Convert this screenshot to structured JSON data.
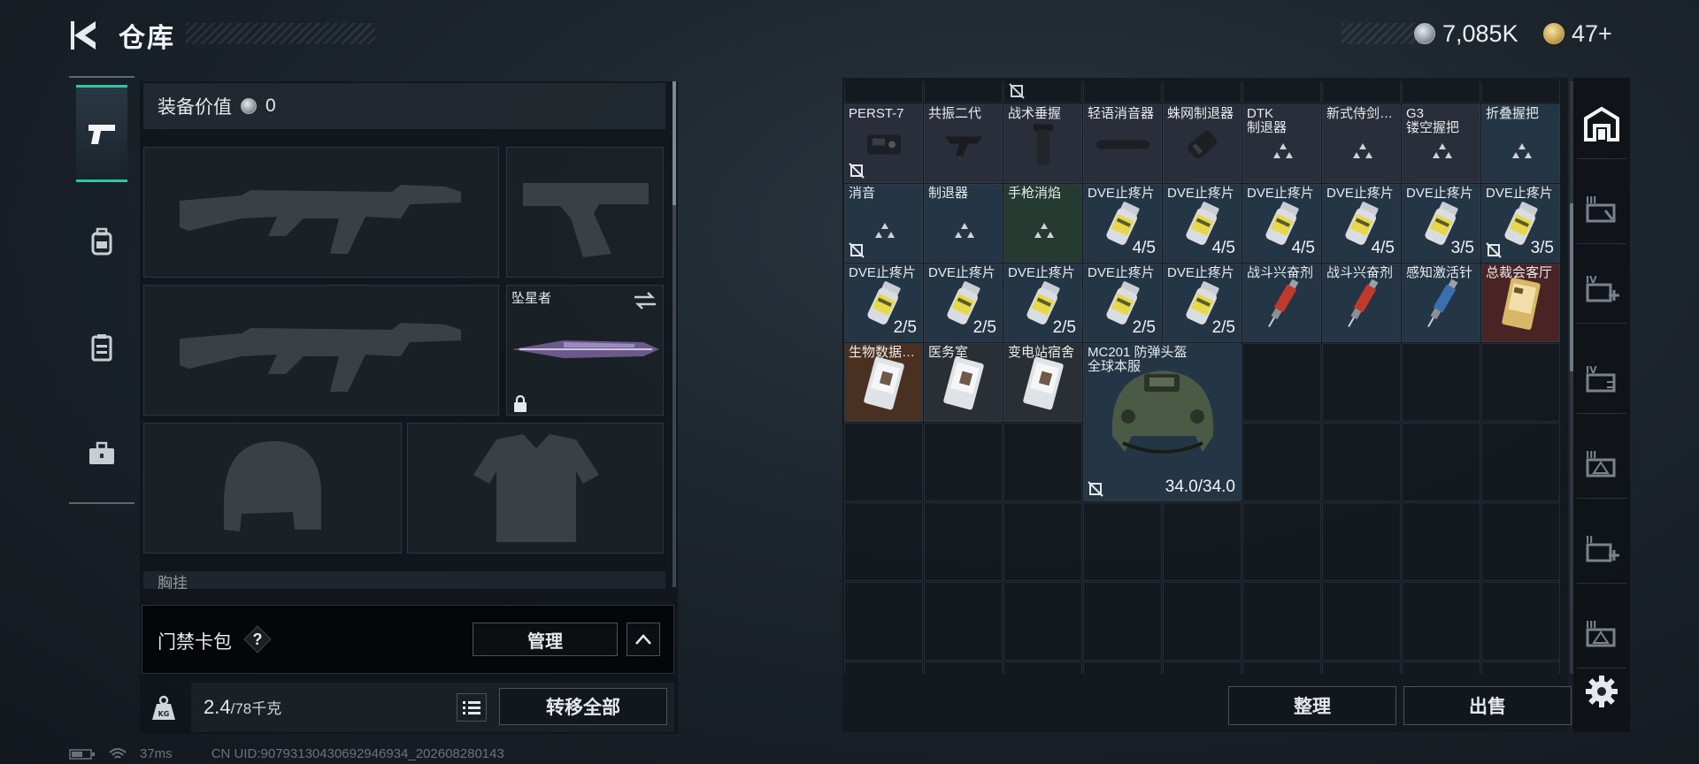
{
  "header": {
    "title": "仓库",
    "currency_value": "7,085K",
    "gold_value": "47+"
  },
  "loadout": {
    "equip_value_label": "装备价值",
    "equip_value": "0",
    "melee_name": "坠星者",
    "chest_rig_label": "胸挂",
    "keycard_label": "门禁卡包",
    "keycard_help": "?",
    "manage_label": "管理",
    "weight_current": "2.4",
    "weight_max": "/78千克",
    "transfer_all_label": "转移全部"
  },
  "status": {
    "ping": "37ms",
    "uid": "CN UID:907931304306929469​34_202608280143"
  },
  "storage": {
    "items": [
      {
        "name": "PERST-7",
        "kind": "gadget",
        "lock": true,
        "count": ""
      },
      {
        "name": "共振二代",
        "kind": "grip",
        "lock": false,
        "count": ""
      },
      {
        "name": "战术垂握",
        "kind": "vgrip",
        "lock": false,
        "count": ""
      },
      {
        "name": "轻语消音器",
        "kind": "silencer",
        "lock": false,
        "count": ""
      },
      {
        "name": "蛛网制退器",
        "kind": "brake",
        "lock": false,
        "count": ""
      },
      {
        "name": "DTK\n制退器",
        "kind": "placeholder",
        "lock": false,
        "count": ""
      },
      {
        "name": "新式侍剑…",
        "kind": "placeholder",
        "lock": false,
        "count": ""
      },
      {
        "name": "G3\n镂空握把",
        "kind": "placeholder",
        "lock": false,
        "count": ""
      },
      {
        "name": "折叠握把",
        "kind": "placeholder",
        "lock": false,
        "count": ""
      },
      {
        "name": "消音",
        "kind": "placeholder",
        "lock": true,
        "count": ""
      },
      {
        "name": "制退器",
        "kind": "placeholder",
        "lock": false,
        "count": ""
      },
      {
        "name": "手枪消焰",
        "kind": "placeholder",
        "lock": false,
        "count": ""
      },
      {
        "name": "DVE止疼片",
        "kind": "pill",
        "lock": false,
        "count": "4/5"
      },
      {
        "name": "DVE止疼片",
        "kind": "pill",
        "lock": false,
        "count": "4/5"
      },
      {
        "name": "DVE止疼片",
        "kind": "pill",
        "lock": false,
        "count": "4/5"
      },
      {
        "name": "DVE止疼片",
        "kind": "pill",
        "lock": false,
        "count": "4/5"
      },
      {
        "name": "DVE止疼片",
        "kind": "pill",
        "lock": false,
        "count": "3/5"
      },
      {
        "name": "DVE止疼片",
        "kind": "pill",
        "lock": true,
        "count": "3/5"
      },
      {
        "name": "DVE止疼片",
        "kind": "pill",
        "lock": false,
        "count": "2/5"
      },
      {
        "name": "DVE止疼片",
        "kind": "pill",
        "lock": false,
        "count": "2/5"
      },
      {
        "name": "DVE止疼片",
        "kind": "pill",
        "lock": false,
        "count": "2/5"
      },
      {
        "name": "DVE止疼片",
        "kind": "pill",
        "lock": false,
        "count": "2/5"
      },
      {
        "name": "DVE止疼片",
        "kind": "pill",
        "lock": false,
        "count": "2/5"
      },
      {
        "name": "战斗兴奋剂",
        "kind": "syringe-red",
        "lock": false,
        "count": ""
      },
      {
        "name": "战斗兴奋剂",
        "kind": "syringe-red",
        "lock": false,
        "count": ""
      },
      {
        "name": "感知激活针",
        "kind": "syringe-blue",
        "lock": false,
        "count": ""
      },
      {
        "name": "总裁会客厅",
        "kind": "keycard-gold",
        "lock": false,
        "count": ""
      },
      {
        "name": "生物数据…",
        "kind": "keycard-white",
        "lock": false,
        "count": ""
      },
      {
        "name": "医务室",
        "kind": "keycard-white",
        "lock": false,
        "count": ""
      },
      {
        "name": "变电站宿舍",
        "kind": "keycard-white",
        "lock": false,
        "count": ""
      },
      {
        "name": "MC201 防弹头盔\n全球本服",
        "kind": "helmet",
        "lock": true,
        "count": "34.0/34.0"
      }
    ],
    "sort_label": "整理",
    "sell_label": "出售"
  },
  "colors": {
    "accent": "#2ec7a4",
    "rarity_purple": "#2a2d3a",
    "rarity_blue": "#243646",
    "rarity_green": "#253a30",
    "rarity_red": "#4a2424",
    "rarity_orange": "#4a3020",
    "rarity_gray": "#2a2f35"
  },
  "icons": [
    "back-arrow-icon",
    "silver-coin-icon",
    "gold-coin-icon",
    "pistol-icon",
    "backpack-icon",
    "chest-rig-icon",
    "briefcase-icon",
    "lock-icon",
    "swap-icon",
    "weight-icon",
    "list-icon",
    "chevron-up-icon",
    "no-trade-icon",
    "settings-icon"
  ]
}
